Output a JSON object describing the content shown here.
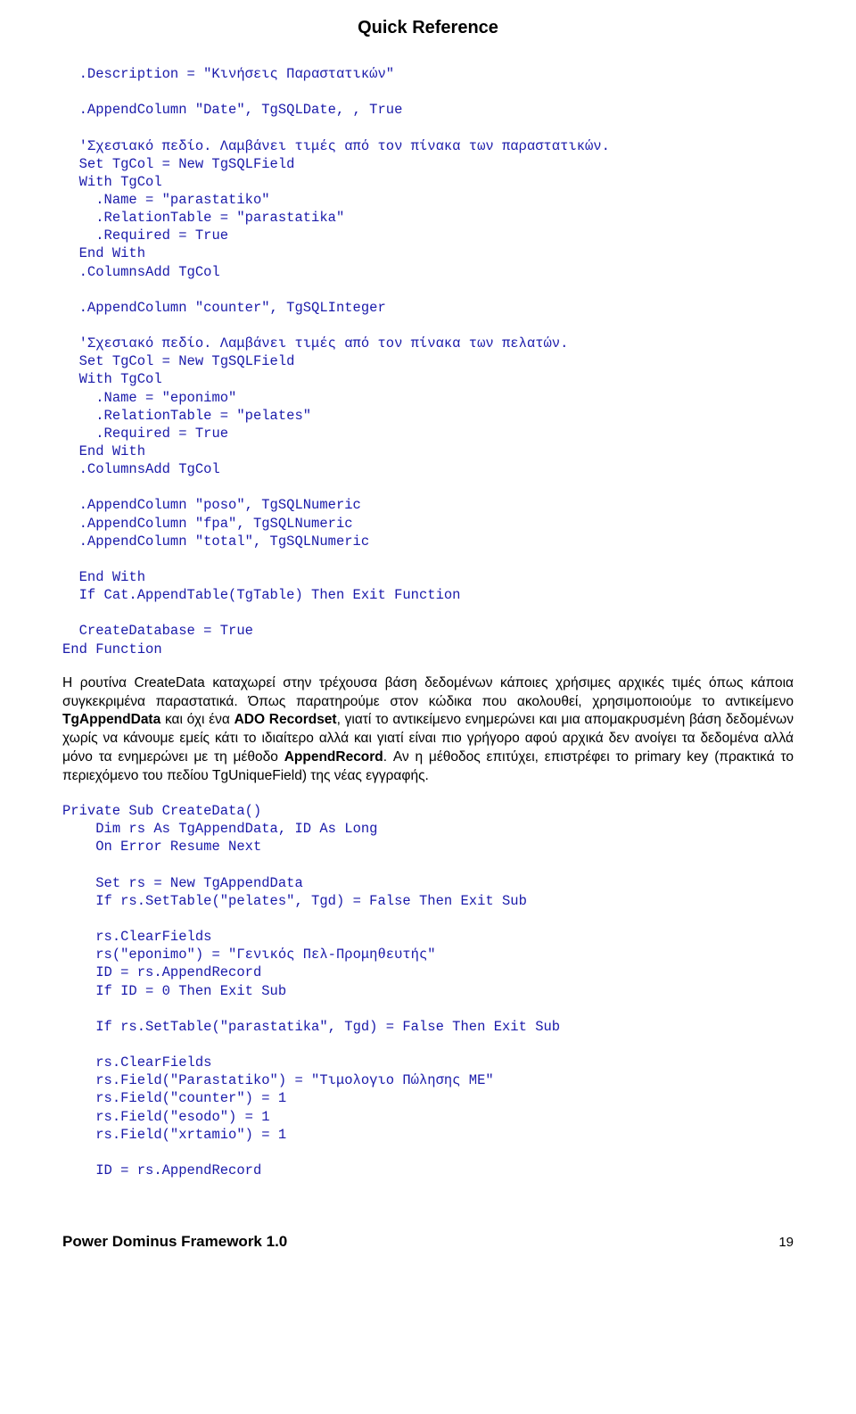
{
  "header": {
    "title": "Quick Reference"
  },
  "code_block_1": "  .Description = \"Κινήσεις Παραστατικών\"\n\n  .AppendColumn \"Date\", TgSQLDate, , True\n\n  'Σχεσιακό πεδίο. Λαμβάνει τιμές από τον πίνακα των παραστατικών.\n  Set TgCol = New TgSQLField\n  With TgCol\n    .Name = \"parastatiko\"\n    .RelationTable = \"parastatika\"\n    .Required = True\n  End With\n  .ColumnsAdd TgCol\n\n  .AppendColumn \"counter\", TgSQLInteger\n\n  'Σχεσιακό πεδίο. Λαμβάνει τιμές από τον πίνακα των πελατών.\n  Set TgCol = New TgSQLField\n  With TgCol\n    .Name = \"eponimo\"\n    .RelationTable = \"pelates\"\n    .Required = True\n  End With\n  .ColumnsAdd TgCol\n\n  .AppendColumn \"poso\", TgSQLNumeric\n  .AppendColumn \"fpa\", TgSQLNumeric\n  .AppendColumn \"total\", TgSQLNumeric\n\n  End With\n  If Cat.AppendTable(TgTable) Then Exit Function\n\n  CreateDatabase = True\nEnd Function",
  "prose": {
    "p1_a": "Η ρουτίνα CreateData καταχωρεί στην τρέχουσα βάση δεδομένων κάποιες χρήσιμες αρχικές τιμές όπως κάποια συγκεκριμένα παραστατικά. Όπως παρατηρούμε στον κώδικα που ακολουθεί, χρησιμοποιούμε το αντικείμενο ",
    "p1_b": " και όχι ένα ",
    "p1_c": ", γιατί το αντικείμενο ενημερώνει και μια απομακρυσμένη βάση δεδομένων χωρίς να κάνουμε εμείς κάτι το ιδιαίτερο αλλά και γιατί είναι πιο γρήγορο αφού αρχικά δεν ανοίγει τα δεδομένα αλλά μόνο τα ενημερώνει με τη μέθοδο ",
    "p1_d": ". Αν η μέθοδος επιτύχει, επιστρέφει το primary key (πρακτικά το περιεχόμενο του πεδίου TgUniqueField) της νέας εγγραφής.",
    "bold1": "TgAppendData",
    "bold2": "ADO Recordset",
    "bold3": "AppendRecord"
  },
  "code_block_2": "Private Sub CreateData()\n    Dim rs As TgAppendData, ID As Long\n    On Error Resume Next\n\n    Set rs = New TgAppendData\n    If rs.SetTable(\"pelates\", Tgd) = False Then Exit Sub\n\n    rs.ClearFields\n    rs(\"eponimo\") = \"Γενικός Πελ-Προμηθευτής\"\n    ID = rs.AppendRecord\n    If ID = 0 Then Exit Sub\n\n    If rs.SetTable(\"parastatika\", Tgd) = False Then Exit Sub\n\n    rs.ClearFields\n    rs.Field(\"Parastatiko\") = \"Τιμολογιο Πώλησης ΜΕ\"\n    rs.Field(\"counter\") = 1\n    rs.Field(\"esodo\") = 1\n    rs.Field(\"xrtamio\") = 1\n\n    ID = rs.AppendRecord",
  "footer": {
    "left": "Power Dominus Framework 1.0",
    "page_no": "19"
  }
}
